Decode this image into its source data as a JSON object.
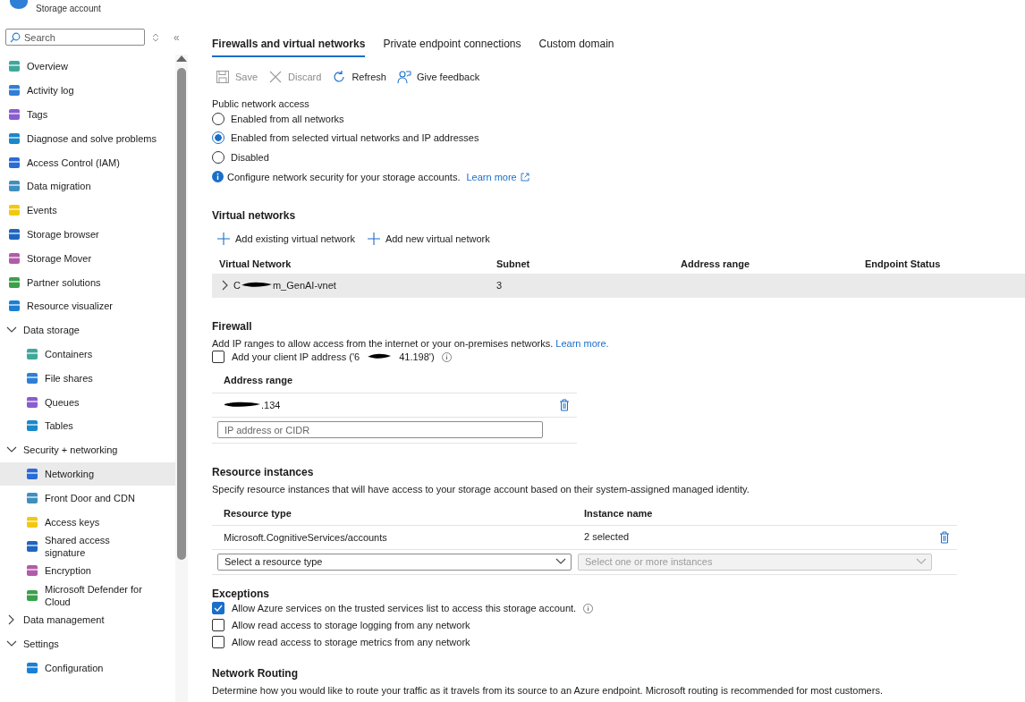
{
  "header": {
    "subtitle": "Storage account"
  },
  "sidebar": {
    "search": {
      "placeholder": "Search"
    },
    "collapse": "«",
    "items": [
      {
        "kind": "item",
        "label": "Overview",
        "selected": false
      },
      {
        "kind": "item",
        "label": "Activity log",
        "selected": false
      },
      {
        "kind": "item",
        "label": "Tags",
        "selected": false
      },
      {
        "kind": "item",
        "label": "Diagnose and solve problems",
        "selected": false
      },
      {
        "kind": "item",
        "label": "Access Control (IAM)",
        "selected": false
      },
      {
        "kind": "item",
        "label": "Data migration",
        "selected": false
      },
      {
        "kind": "item",
        "label": "Events",
        "selected": false
      },
      {
        "kind": "item",
        "label": "Storage browser",
        "selected": false
      },
      {
        "kind": "item",
        "label": "Storage Mover",
        "selected": false
      },
      {
        "kind": "item",
        "label": "Partner solutions",
        "selected": false
      },
      {
        "kind": "item",
        "label": "Resource visualizer",
        "selected": false
      },
      {
        "kind": "group",
        "label": "Data storage",
        "expanded": true,
        "children": [
          {
            "kind": "item",
            "label": "Containers",
            "selected": false
          },
          {
            "kind": "item",
            "label": "File shares",
            "selected": false
          },
          {
            "kind": "item",
            "label": "Queues",
            "selected": false
          },
          {
            "kind": "item",
            "label": "Tables",
            "selected": false
          }
        ]
      },
      {
        "kind": "group",
        "label": "Security + networking",
        "expanded": true,
        "children": [
          {
            "kind": "item",
            "label": "Networking",
            "selected": true
          },
          {
            "kind": "item",
            "label": "Front Door and CDN",
            "selected": false
          },
          {
            "kind": "item",
            "label": "Access keys",
            "selected": false
          },
          {
            "kind": "item",
            "label": "Shared access signature",
            "selected": false
          },
          {
            "kind": "item",
            "label": "Encryption",
            "selected": false
          },
          {
            "kind": "item",
            "label": "Microsoft Defender for Cloud",
            "selected": false
          }
        ]
      },
      {
        "kind": "group",
        "label": "Data management",
        "expanded": false
      },
      {
        "kind": "group",
        "label": "Settings",
        "expanded": true,
        "children": [
          {
            "kind": "item",
            "label": "Configuration",
            "selected": false
          }
        ]
      }
    ]
  },
  "tabs": [
    {
      "label": "Firewalls and virtual networks",
      "selected": true
    },
    {
      "label": "Private endpoint connections",
      "selected": false
    },
    {
      "label": "Custom domain",
      "selected": false
    }
  ],
  "toolbar": [
    {
      "kind": "save",
      "label": "Save",
      "disabled": true
    },
    {
      "kind": "discard",
      "label": "Discard",
      "disabled": true
    },
    {
      "kind": "refresh",
      "label": "Refresh",
      "disabled": false
    },
    {
      "kind": "feedback",
      "label": "Give feedback",
      "disabled": false
    }
  ],
  "public_access": {
    "label": "Public network access",
    "options": [
      {
        "label": "Enabled from all networks",
        "selected": false
      },
      {
        "label": "Enabled from selected virtual networks and IP addresses",
        "selected": true
      },
      {
        "label": "Disabled",
        "selected": false
      }
    ],
    "info": "Configure network security for your storage accounts.",
    "link": "Learn more"
  },
  "virtual_networks": {
    "heading": "Virtual networks",
    "actions": [
      "Add existing virtual network",
      "Add new virtual network"
    ],
    "columns": [
      "Virtual Network",
      "Subnet",
      "Address range",
      "Endpoint Status"
    ],
    "rows": [
      {
        "expanded": false,
        "name_start": "C",
        "name_end": "m_GenAI-vnet",
        "subnet": "3"
      }
    ]
  },
  "firewall": {
    "heading": "Firewall",
    "description": "Add IP ranges to allow access from the internet or your on-premises networks.",
    "link": "Learn more.",
    "client_ip": {
      "checked": false,
      "prefix": "Add your client IP address ('6",
      "suffix": "41.198')"
    },
    "column": "Address range",
    "rows": [
      {
        "address_end": ".134"
      }
    ],
    "input": {
      "placeholder": "IP address or CIDR"
    }
  },
  "resource_instances": {
    "heading": "Resource instances",
    "description": "Specify resource instances that will have access to your storage account based on their system-assigned managed identity.",
    "columns": [
      "Resource type",
      "Instance name"
    ],
    "rows": [
      {
        "type": "Microsoft.CognitiveServices/accounts",
        "instances": "2 selected"
      }
    ],
    "selects": [
      {
        "placeholder": "Select a resource type",
        "disabled": false
      },
      {
        "placeholder": "Select one or more instances",
        "disabled": true
      }
    ]
  },
  "exceptions": {
    "heading": "Exceptions",
    "items": [
      {
        "label": "Allow Azure services on the trusted services list to access this storage account.",
        "checked": true,
        "info": true
      },
      {
        "label": "Allow read access to storage logging from any network",
        "checked": false,
        "info": false
      },
      {
        "label": "Allow read access to storage metrics from any network",
        "checked": false,
        "info": false
      }
    ]
  },
  "network_routing": {
    "heading": "Network Routing",
    "description": "Determine how you would like to route your traffic as it travels from its source to an Azure endpoint. Microsoft routing is recommended for most customers."
  }
}
